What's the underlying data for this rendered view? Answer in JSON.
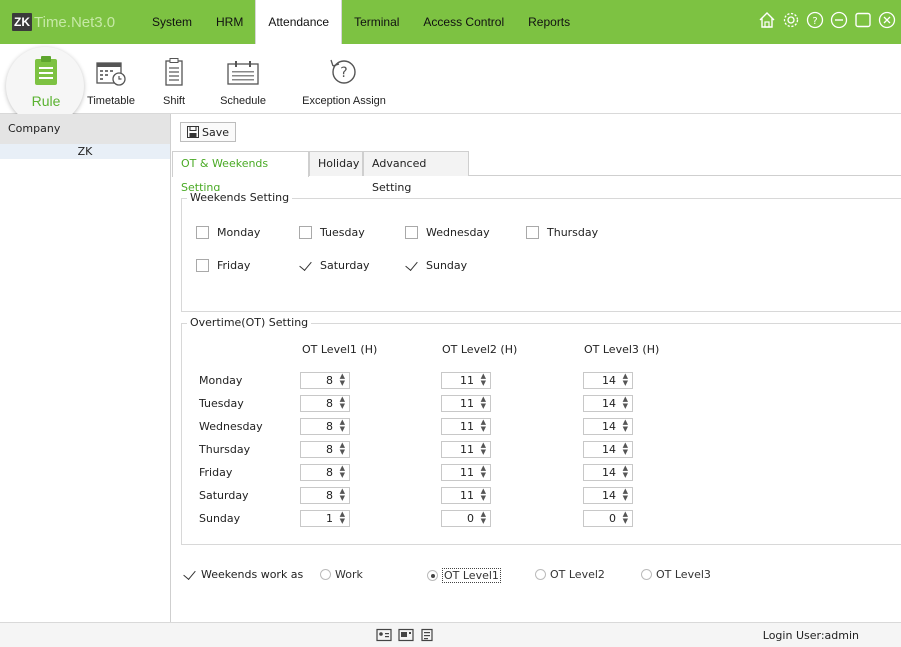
{
  "app": {
    "logo_zk": "ZK",
    "logo_text": "Time.Net",
    "logo_version": " 3.0"
  },
  "menu": [
    {
      "label": "System"
    },
    {
      "label": "HRM"
    },
    {
      "label": "Attendance"
    },
    {
      "label": "Terminal"
    },
    {
      "label": "Access Control"
    },
    {
      "label": "Reports"
    }
  ],
  "window_controls": [
    "home-icon",
    "settings-icon",
    "help-icon",
    "minimize-icon",
    "maximize-icon",
    "close-icon"
  ],
  "toolbar": {
    "rule": "Rule",
    "timetable": "Timetable",
    "shift": "Shift",
    "schedule": "Schedule",
    "exception": "Exception Assign"
  },
  "left_panel": {
    "header": "Company",
    "items": [
      "ZK"
    ]
  },
  "save_label": "Save",
  "tabs": [
    "OT & Weekends Setting",
    "Holiday",
    "Advanced Setting"
  ],
  "weekends": {
    "title": "Weekends Setting",
    "days": [
      {
        "label": "Monday",
        "checked": false
      },
      {
        "label": "Tuesday",
        "checked": false
      },
      {
        "label": "Wednesday",
        "checked": false
      },
      {
        "label": "Thursday",
        "checked": false
      },
      {
        "label": "Friday",
        "checked": false
      },
      {
        "label": "Saturday",
        "checked": true
      },
      {
        "label": "Sunday",
        "checked": true
      }
    ]
  },
  "overtime": {
    "title": "Overtime(OT) Setting",
    "columns": [
      "OT Level1 (H)",
      "OT Level2 (H)",
      "OT Level3 (H)"
    ],
    "rows": [
      {
        "day": "Monday",
        "values": [
          "8",
          "11",
          "14"
        ]
      },
      {
        "day": "Tuesday",
        "values": [
          "8",
          "11",
          "14"
        ]
      },
      {
        "day": "Wednesday",
        "values": [
          "8",
          "11",
          "14"
        ]
      },
      {
        "day": "Thursday",
        "values": [
          "8",
          "11",
          "14"
        ]
      },
      {
        "day": "Friday",
        "values": [
          "8",
          "11",
          "14"
        ]
      },
      {
        "day": "Saturday",
        "values": [
          "8",
          "11",
          "14"
        ]
      },
      {
        "day": "Sunday",
        "values": [
          "1",
          "0",
          "0"
        ]
      }
    ]
  },
  "weekends_work": {
    "label": "Weekends work as",
    "checked": true,
    "options": [
      "Work",
      "OT Level1",
      "OT Level2",
      "OT Level3"
    ],
    "selected": "OT Level1"
  },
  "status": {
    "user": "Login User:admin"
  },
  "colors": {
    "accent": "#7dc242",
    "active_tab_text": "#4aaa25"
  }
}
